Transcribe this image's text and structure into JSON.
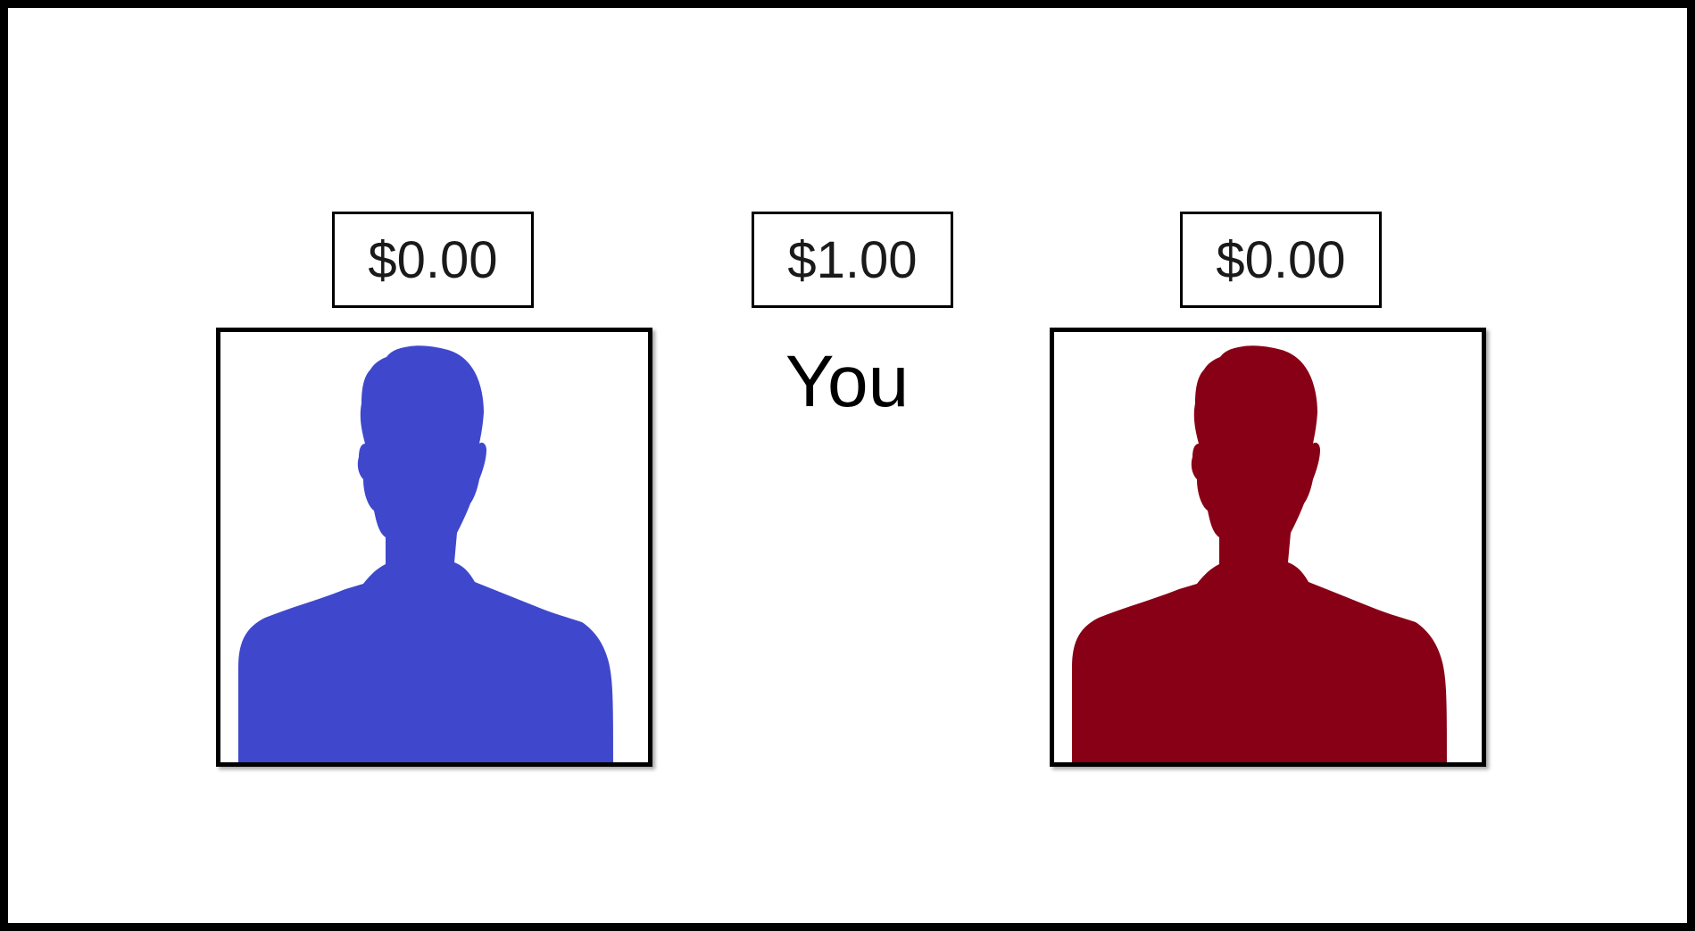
{
  "players": {
    "left": {
      "amount": "$0.00",
      "color": "#3f48cc"
    },
    "center": {
      "amount": "$1.00",
      "label": "You"
    },
    "right": {
      "amount": "$0.00",
      "color": "#880015"
    }
  },
  "icons": {
    "left_avatar": "person-silhouette-icon",
    "right_avatar": "person-silhouette-icon"
  }
}
